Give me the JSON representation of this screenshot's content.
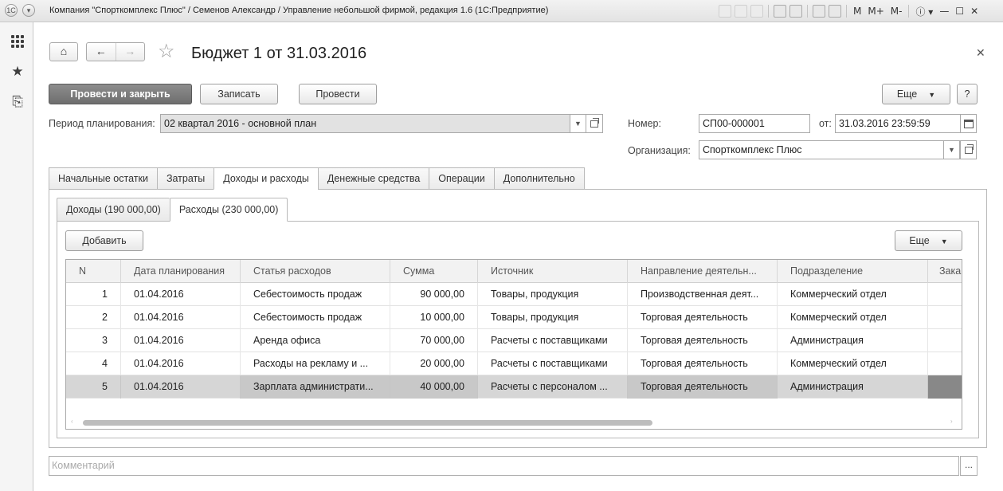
{
  "window": {
    "title": "Компания \"Спорткомплекс Плюс\" / Семенов Александр / Управление небольшой фирмой, редакция 1.6  (1С:Предприятие)",
    "toolbar_text": [
      "M",
      "M+",
      "M-"
    ]
  },
  "document": {
    "title": "Бюджет 1 от 31.03.2016"
  },
  "actions": {
    "post_close": "Провести и закрыть",
    "save": "Записать",
    "post": "Провести",
    "more": "Еще",
    "help": "?"
  },
  "form": {
    "period_label": "Период планирования:",
    "period_value": "02 квартал 2016 - основной план",
    "number_label": "Номер:",
    "number_value": "СП00-000001",
    "date_label": "от:",
    "date_value": "31.03.2016 23:59:59",
    "org_label": "Организация:",
    "org_value": "Спорткомплекс Плюс"
  },
  "tabs": [
    {
      "label": "Начальные остатки",
      "active": false
    },
    {
      "label": "Затраты",
      "active": false
    },
    {
      "label": "Доходы и расходы",
      "active": true
    },
    {
      "label": "Денежные средства",
      "active": false
    },
    {
      "label": "Операции",
      "active": false
    },
    {
      "label": "Дополнительно",
      "active": false
    }
  ],
  "subtabs": [
    {
      "label": "Доходы (190 000,00)",
      "active": false
    },
    {
      "label": "Расходы (230 000,00)",
      "active": true
    }
  ],
  "table_actions": {
    "add": "Добавить",
    "more": "Еще"
  },
  "table": {
    "columns": [
      "N",
      "Дата планирования",
      "Статья расходов",
      "Сумма",
      "Источник",
      "Направление деятельн...",
      "Подразделение",
      "Зака"
    ],
    "rows": [
      [
        "1",
        "01.04.2016",
        "Себестоимость продаж",
        "90 000,00",
        "Товары, продукция",
        "Производственная деят...",
        "Коммерческий отдел"
      ],
      [
        "2",
        "01.04.2016",
        "Себестоимость продаж",
        "10 000,00",
        "Товары, продукция",
        "Торговая деятельность",
        "Коммерческий отдел"
      ],
      [
        "3",
        "01.04.2016",
        "Аренда офиса",
        "70 000,00",
        "Расчеты с поставщиками",
        "Торговая деятельность",
        "Администрация"
      ],
      [
        "4",
        "01.04.2016",
        "Расходы на рекламу и ...",
        "20 000,00",
        "Расчеты с поставщиками",
        "Торговая деятельность",
        "Коммерческий отдел"
      ],
      [
        "5",
        "01.04.2016",
        "Зарплата администрати...",
        "40 000,00",
        "Расчеты с персоналом ...",
        "Торговая деятельность",
        "Администрация"
      ]
    ],
    "selected_row": 4
  },
  "comment": {
    "placeholder": "Комментарий",
    "button": "..."
  }
}
